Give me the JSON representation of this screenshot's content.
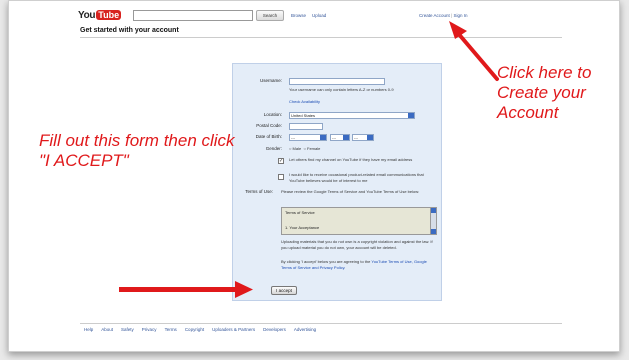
{
  "header": {
    "logo_you": "You",
    "logo_tube": "Tube",
    "search_button": "Search",
    "links": [
      "Browse",
      "Upload"
    ],
    "create_account": "Create Account",
    "sign_in": "Sign In"
  },
  "page_title": "Get started with your account",
  "form": {
    "username_label": "Username:",
    "username_hint": "Your username can only contain letters A-Z or numbers 0-9",
    "check_availability": "Check Availability",
    "location_label": "Location:",
    "location_value": "United States",
    "postal_label": "Postal Code:",
    "dob_label": "Date of Birth:",
    "dob_month": "---",
    "dob_day": "---",
    "dob_year": "---",
    "gender_label": "Gender:",
    "gender_male": "Male",
    "gender_female": "Female",
    "email_opt_in": "Let others find my channel on YouTube if they have my email address",
    "promo_opt_in": "I would like to receive occasional product-related email communications that YouTube believes would be of interest to me",
    "terms_label": "Terms of Use:",
    "terms_intro": "Please review the Google Terms of Service and YouTube Terms of Use below:",
    "tos_title": "Terms of Service",
    "tos_item": "1. Your Acceptance",
    "copyright_note": "Uploading materials that you do not own is a copyright violation and against the law. If you upload material you do not own, your account will be deleted.",
    "agree_prefix": "By clicking 'I accept' below you are agreeing to the",
    "agree_links": "YouTube Terms of Use, Google Terms of Service and Privacy Policy.",
    "accept_button": "I accept"
  },
  "footer": {
    "links": [
      "Help",
      "About",
      "Safety",
      "Privacy",
      "Terms",
      "Copyright",
      "Uploaders & Partners",
      "Developers",
      "Advertising"
    ]
  },
  "annotations": {
    "left": "Fill out this form then click \"I ACCEPT\"",
    "right": "Click here to Create your Account"
  },
  "colors": {
    "annotation": "#e0191b",
    "panel": "#e4edf8",
    "link": "#1a4bb3"
  }
}
